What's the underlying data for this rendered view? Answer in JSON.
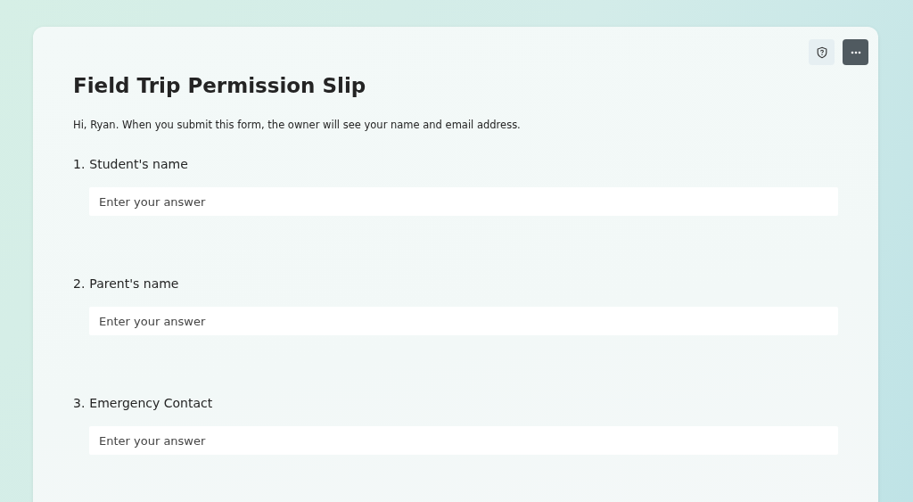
{
  "form": {
    "title": "Field Trip Permission Slip",
    "notice": "Hi, Ryan. When you submit this form, the owner will see your name and email address."
  },
  "questions": [
    {
      "number": "1.",
      "label": "Student's name",
      "placeholder": "Enter your answer"
    },
    {
      "number": "2.",
      "label": "Parent's name",
      "placeholder": "Enter your answer"
    },
    {
      "number": "3.",
      "label": "Emergency Contact",
      "placeholder": "Enter your answer"
    }
  ]
}
